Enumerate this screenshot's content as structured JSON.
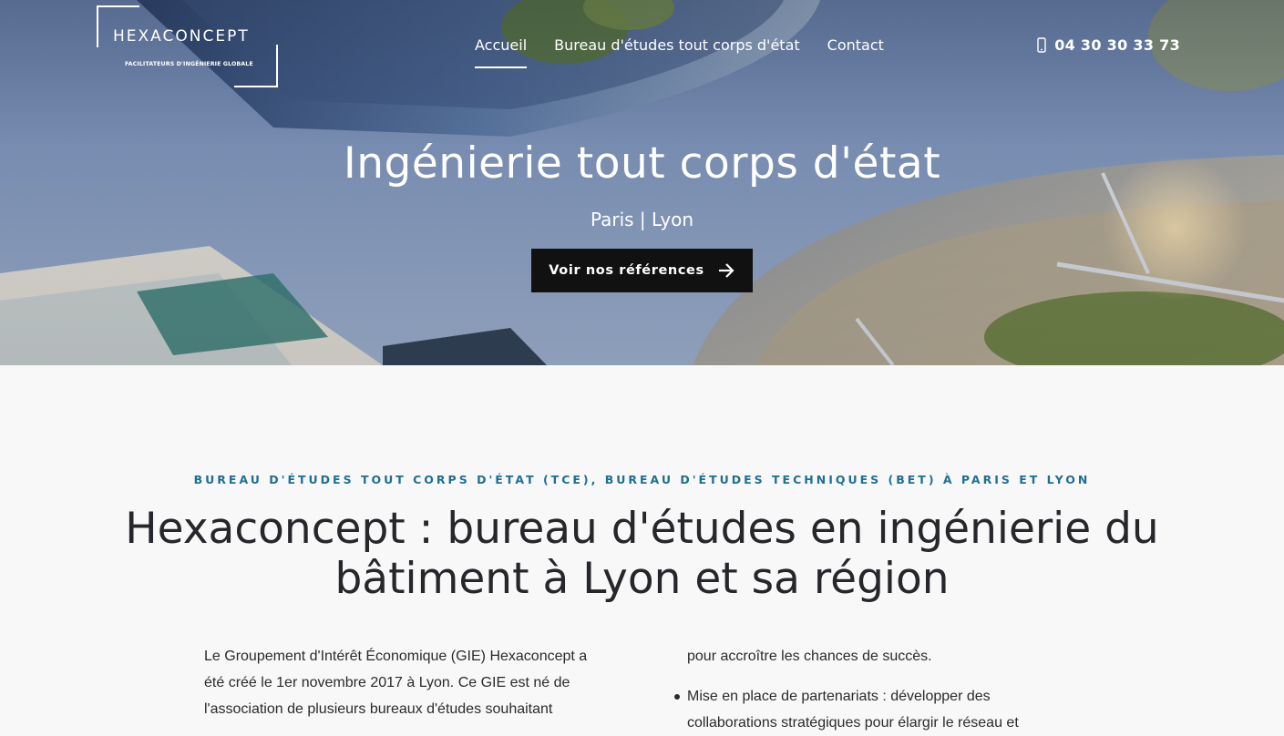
{
  "header": {
    "logo": {
      "name": "HEXACONCEPT",
      "tagline": "FACILITATEURS D'INGÉNIERIE GLOBALE"
    },
    "nav": [
      {
        "label": "Accueil",
        "active": true
      },
      {
        "label": "Bureau d'études tout corps d'état",
        "active": false
      },
      {
        "label": "Contact",
        "active": false
      }
    ],
    "phone": "04 30 30 33 73"
  },
  "hero": {
    "title": "Ingénierie tout corps d'état",
    "subtitle": "Paris | Lyon",
    "cta_label": "Voir nos références"
  },
  "content": {
    "kicker": "BUREAU D'ÉTUDES TOUT CORPS D'ÉTAT (TCE), BUREAU D'ÉTUDES TECHNIQUES (BET) À PARIS ET LYON",
    "title_line1": "Hexaconcept : bureau d'études en ingénierie du",
    "title_line2": "bâtiment à Lyon et sa région",
    "left_lines": [
      "Le Groupement d'Intérêt Économique (GIE) Hexaconcept a",
      "été créé le 1er novembre 2017 à Lyon. Ce GIE est né de",
      "l'association de plusieurs bureaux d'études souhaitant"
    ],
    "right_line": "pour accroître les chances de succès.",
    "right_bullet_lines": [
      "Mise en place de partenariats : développer des",
      "collaborations stratégiques pour élargir le réseau et"
    ]
  },
  "colors": {
    "accent": "#1f6f91",
    "cta_bg": "#111111",
    "title_text": "#26262b",
    "page_bg": "#f8f8f8"
  }
}
